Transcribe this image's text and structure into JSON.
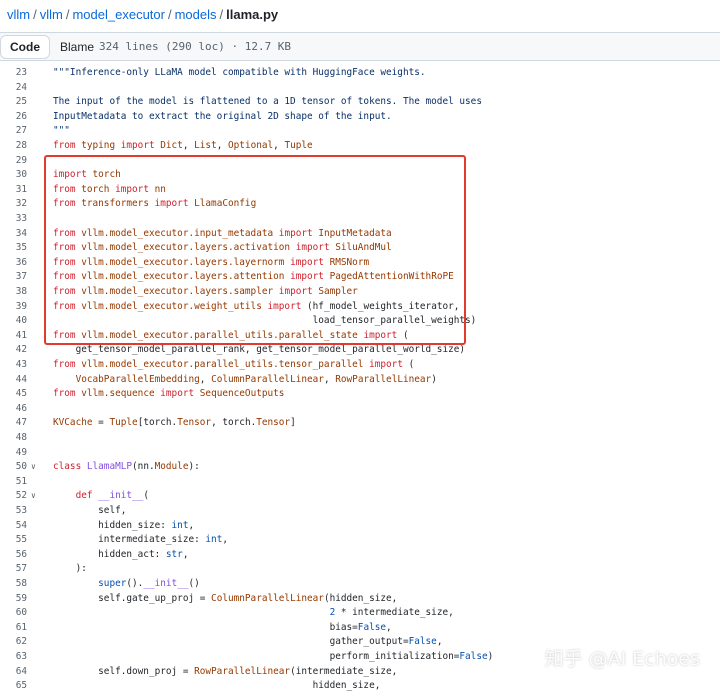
{
  "breadcrumb": {
    "parts": [
      "vllm",
      "vllm",
      "model_executor",
      "models"
    ],
    "separator": "/",
    "file": "llama.py"
  },
  "toolbar": {
    "code_label": "Code",
    "blame_label": "Blame",
    "file_info": "324 lines (290 loc) · 12.7 KB"
  },
  "watermark": "知乎 @AI Echoes",
  "colors": {
    "keyword": "#cf222e",
    "name": "#953800",
    "string": "#0a3069",
    "function": "#8250df",
    "constant": "#0550ae",
    "highlight": "#e23b2e"
  },
  "code": {
    "lines": [
      {
        "n": "23",
        "t": [
          [
            "st",
            "\"\"\"Inference-only LLaMA model compatible with HuggingFace weights."
          ]
        ]
      },
      {
        "n": "24",
        "t": [
          [
            "",
            ""
          ]
        ]
      },
      {
        "n": "25",
        "t": [
          [
            "st",
            "The input of the model is flattened to a 1D tensor of tokens. The model uses"
          ]
        ]
      },
      {
        "n": "26",
        "t": [
          [
            "st",
            "InputMetadata to extract the original 2D shape of the input."
          ]
        ]
      },
      {
        "n": "27",
        "t": [
          [
            "st",
            "\"\"\""
          ]
        ]
      },
      {
        "n": "28",
        "t": [
          [
            "kw",
            "from "
          ],
          [
            "nm",
            "typing "
          ],
          [
            "kw",
            "import "
          ],
          [
            "nm",
            "Dict"
          ],
          [
            "",
            ", "
          ],
          [
            "nm",
            "List"
          ],
          [
            "",
            ", "
          ],
          [
            "nm",
            "Optional"
          ],
          [
            "",
            ", "
          ],
          [
            "nm",
            "Tuple"
          ]
        ]
      },
      {
        "n": "29",
        "t": [
          [
            "",
            ""
          ]
        ]
      },
      {
        "n": "30",
        "t": [
          [
            "kw",
            "import "
          ],
          [
            "nm",
            "torch"
          ]
        ]
      },
      {
        "n": "31",
        "t": [
          [
            "kw",
            "from "
          ],
          [
            "nm",
            "torch "
          ],
          [
            "kw",
            "import "
          ],
          [
            "nm",
            "nn"
          ]
        ]
      },
      {
        "n": "32",
        "t": [
          [
            "kw",
            "from "
          ],
          [
            "nm",
            "transformers "
          ],
          [
            "kw",
            "import "
          ],
          [
            "nm",
            "LlamaConfig"
          ]
        ]
      },
      {
        "n": "33",
        "t": [
          [
            "",
            ""
          ]
        ]
      },
      {
        "n": "34",
        "t": [
          [
            "kw",
            "from "
          ],
          [
            "nm",
            "vllm.model_executor.input_metadata "
          ],
          [
            "kw",
            "import "
          ],
          [
            "nm",
            "InputMetadata"
          ]
        ]
      },
      {
        "n": "35",
        "t": [
          [
            "kw",
            "from "
          ],
          [
            "nm",
            "vllm.model_executor.layers.activation "
          ],
          [
            "kw",
            "import "
          ],
          [
            "nm",
            "SiluAndMul"
          ]
        ]
      },
      {
        "n": "36",
        "t": [
          [
            "kw",
            "from "
          ],
          [
            "nm",
            "vllm.model_executor.layers.layernorm "
          ],
          [
            "kw",
            "import "
          ],
          [
            "nm",
            "RMSNorm"
          ]
        ]
      },
      {
        "n": "37",
        "t": [
          [
            "kw",
            "from "
          ],
          [
            "nm",
            "vllm.model_executor.layers.attention "
          ],
          [
            "kw",
            "import "
          ],
          [
            "nm",
            "PagedAttentionWithRoPE"
          ]
        ]
      },
      {
        "n": "38",
        "t": [
          [
            "kw",
            "from "
          ],
          [
            "nm",
            "vllm.model_executor.layers.sampler "
          ],
          [
            "kw",
            "import "
          ],
          [
            "nm",
            "Sampler"
          ]
        ]
      },
      {
        "n": "39",
        "t": [
          [
            "kw",
            "from "
          ],
          [
            "nm",
            "vllm.model_executor.weight_utils "
          ],
          [
            "kw",
            "import "
          ],
          [
            "",
            "(hf_model_weights_iterator,"
          ]
        ]
      },
      {
        "n": "40",
        "t": [
          [
            "",
            "                                              load_tensor_parallel_weights)"
          ]
        ]
      },
      {
        "n": "41",
        "t": [
          [
            "kw",
            "from "
          ],
          [
            "nm",
            "vllm.model_executor.parallel_utils.parallel_state "
          ],
          [
            "kw",
            "import "
          ],
          [
            "",
            "("
          ]
        ]
      },
      {
        "n": "42",
        "t": [
          [
            "",
            "    get_tensor_model_parallel_rank, get_tensor_model_parallel_world_size)"
          ]
        ]
      },
      {
        "n": "43",
        "t": [
          [
            "kw",
            "from "
          ],
          [
            "nm",
            "vllm.model_executor.parallel_utils.tensor_parallel "
          ],
          [
            "kw",
            "import "
          ],
          [
            "",
            "("
          ]
        ]
      },
      {
        "n": "44",
        "t": [
          [
            "",
            "    "
          ],
          [
            "nm",
            "VocabParallelEmbedding"
          ],
          [
            "",
            ", "
          ],
          [
            "nm",
            "ColumnParallelLinear"
          ],
          [
            "",
            ", "
          ],
          [
            "nm",
            "RowParallelLinear"
          ],
          [
            "",
            ")"
          ]
        ]
      },
      {
        "n": "45",
        "t": [
          [
            "kw",
            "from "
          ],
          [
            "nm",
            "vllm.sequence "
          ],
          [
            "kw",
            "import "
          ],
          [
            "nm",
            "SequenceOutputs"
          ]
        ]
      },
      {
        "n": "46",
        "t": [
          [
            "",
            ""
          ]
        ]
      },
      {
        "n": "47",
        "t": [
          [
            "nm",
            "KVCache "
          ],
          [
            "",
            "= "
          ],
          [
            "nm",
            "Tuple"
          ],
          [
            "",
            "[torch."
          ],
          [
            "nm",
            "Tensor"
          ],
          [
            "",
            ", torch."
          ],
          [
            "nm",
            "Tensor"
          ],
          [
            "",
            "]"
          ]
        ]
      },
      {
        "n": "48",
        "t": [
          [
            "",
            ""
          ]
        ]
      },
      {
        "n": "49",
        "t": [
          [
            "",
            ""
          ]
        ]
      },
      {
        "n": "50",
        "fold": true,
        "t": [
          [
            "kw",
            "class "
          ],
          [
            "fn",
            "LlamaMLP"
          ],
          [
            "",
            "(nn."
          ],
          [
            "nm",
            "Module"
          ],
          [
            "",
            "):"
          ]
        ]
      },
      {
        "n": "51",
        "t": [
          [
            "",
            ""
          ]
        ]
      },
      {
        "n": "52",
        "fold": true,
        "t": [
          [
            "",
            "    "
          ],
          [
            "kw",
            "def "
          ],
          [
            "fn",
            "__init__"
          ],
          [
            "",
            "("
          ]
        ]
      },
      {
        "n": "53",
        "t": [
          [
            "",
            "        self,"
          ]
        ]
      },
      {
        "n": "54",
        "t": [
          [
            "",
            "        hidden_size: "
          ],
          [
            "cn",
            "int"
          ],
          [
            "",
            ","
          ]
        ]
      },
      {
        "n": "55",
        "t": [
          [
            "",
            "        intermediate_size: "
          ],
          [
            "cn",
            "int"
          ],
          [
            "",
            ","
          ]
        ]
      },
      {
        "n": "56",
        "t": [
          [
            "",
            "        hidden_act: "
          ],
          [
            "cn",
            "str"
          ],
          [
            "",
            ","
          ]
        ]
      },
      {
        "n": "57",
        "t": [
          [
            "",
            "    ):"
          ]
        ]
      },
      {
        "n": "58",
        "t": [
          [
            "",
            "        "
          ],
          [
            "cn",
            "super"
          ],
          [
            "",
            "()."
          ],
          [
            "fn",
            "__init__"
          ],
          [
            "",
            "()"
          ]
        ]
      },
      {
        "n": "59",
        "t": [
          [
            "",
            "        self.gate_up_proj = "
          ],
          [
            "nm",
            "ColumnParallelLinear"
          ],
          [
            "",
            "(hidden_size,"
          ]
        ]
      },
      {
        "n": "60",
        "t": [
          [
            "",
            "                                                 "
          ],
          [
            "cn",
            "2"
          ],
          [
            "",
            " * intermediate_size,"
          ]
        ]
      },
      {
        "n": "61",
        "t": [
          [
            "",
            "                                                 bias="
          ],
          [
            "cn",
            "False"
          ],
          [
            "",
            ","
          ]
        ]
      },
      {
        "n": "62",
        "t": [
          [
            "",
            "                                                 gather_output="
          ],
          [
            "cn",
            "False"
          ],
          [
            "",
            ","
          ]
        ]
      },
      {
        "n": "63",
        "t": [
          [
            "",
            "                                                 perform_initialization="
          ],
          [
            "cn",
            "False"
          ],
          [
            "",
            ")"
          ]
        ]
      },
      {
        "n": "64",
        "t": [
          [
            "",
            "        self.down_proj = "
          ],
          [
            "nm",
            "RowParallelLinear"
          ],
          [
            "",
            "(intermediate_size,"
          ]
        ]
      },
      {
        "n": "65",
        "t": [
          [
            "",
            "                                              hidden_size,"
          ]
        ]
      }
    ]
  }
}
